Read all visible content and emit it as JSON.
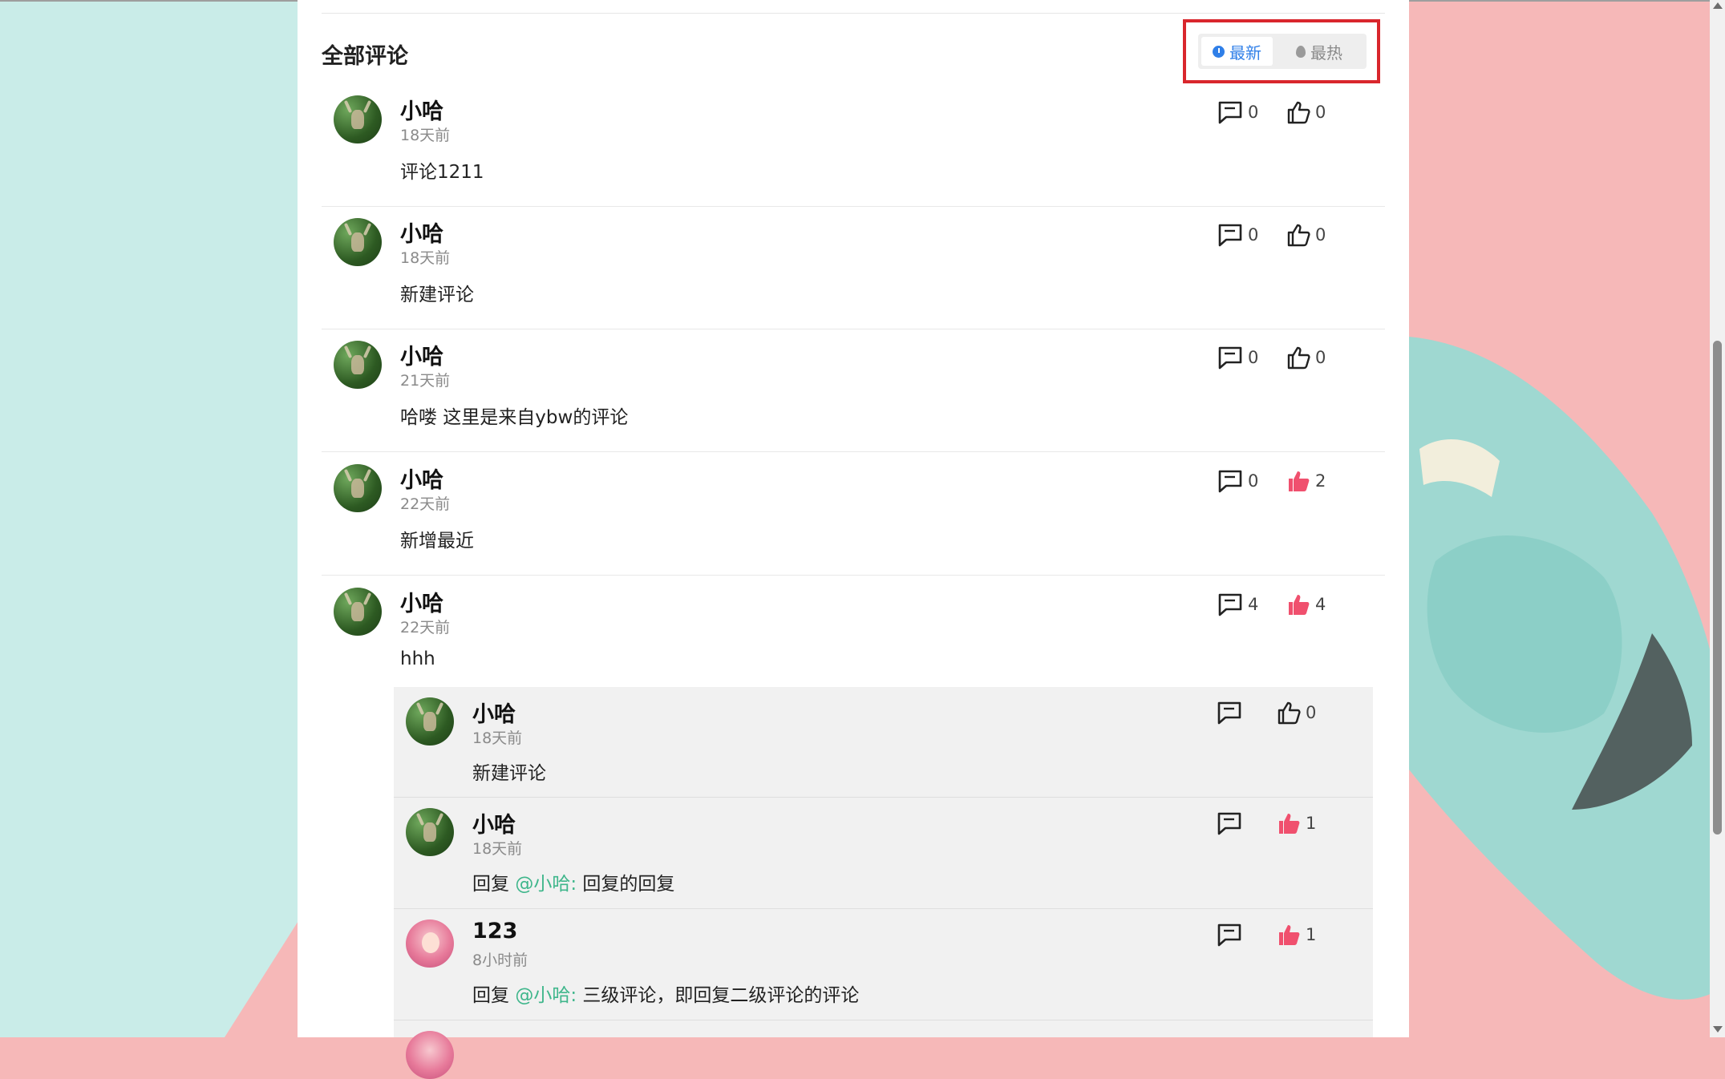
{
  "section": {
    "title": "全部评论"
  },
  "sort": {
    "newest_label": "最新",
    "hot_label": "最热",
    "active": "newest",
    "active_color": "#2f7fe8"
  },
  "colors": {
    "liked": "#f0506e",
    "mention": "#3fb68b"
  },
  "comments": [
    {
      "name": "小哈",
      "time": "18天前",
      "text": "评论1211",
      "reply_count": "0",
      "like_count": "0",
      "liked": false,
      "avatar": "deer-forest-icon"
    },
    {
      "name": "小哈",
      "time": "18天前",
      "text": "新建评论",
      "reply_count": "0",
      "like_count": "0",
      "liked": false,
      "avatar": "deer-forest-icon"
    },
    {
      "name": "小哈",
      "time": "21天前",
      "text": "哈喽 这里是来自ybw的评论",
      "reply_count": "0",
      "like_count": "0",
      "liked": false,
      "avatar": "deer-forest-icon"
    },
    {
      "name": "小哈",
      "time": "22天前",
      "text": "新增最近",
      "reply_count": "0",
      "like_count": "2",
      "liked": true,
      "avatar": "deer-forest-icon"
    },
    {
      "name": "小哈",
      "time": "22天前",
      "text": "hhh",
      "reply_count": "4",
      "like_count": "4",
      "liked": true,
      "avatar": "deer-forest-icon"
    }
  ],
  "replies": [
    {
      "name": "小哈",
      "time": "18天前",
      "prefix": "",
      "mention": "",
      "text": "新建评论",
      "like_count": "0",
      "liked": false,
      "avatar": "deer-forest-icon"
    },
    {
      "name": "小哈",
      "time": "18天前",
      "prefix": "回复 ",
      "mention": "@小哈:",
      "text": " 回复的回复",
      "like_count": "1",
      "liked": true,
      "avatar": "deer-forest-icon"
    },
    {
      "name": "123",
      "time": "8小时前",
      "prefix": "回复 ",
      "mention": "@小哈:",
      "text": " 三级评论，即回复二级评论的评论",
      "like_count": "1",
      "liked": true,
      "avatar": "anime-girl-icon"
    }
  ]
}
